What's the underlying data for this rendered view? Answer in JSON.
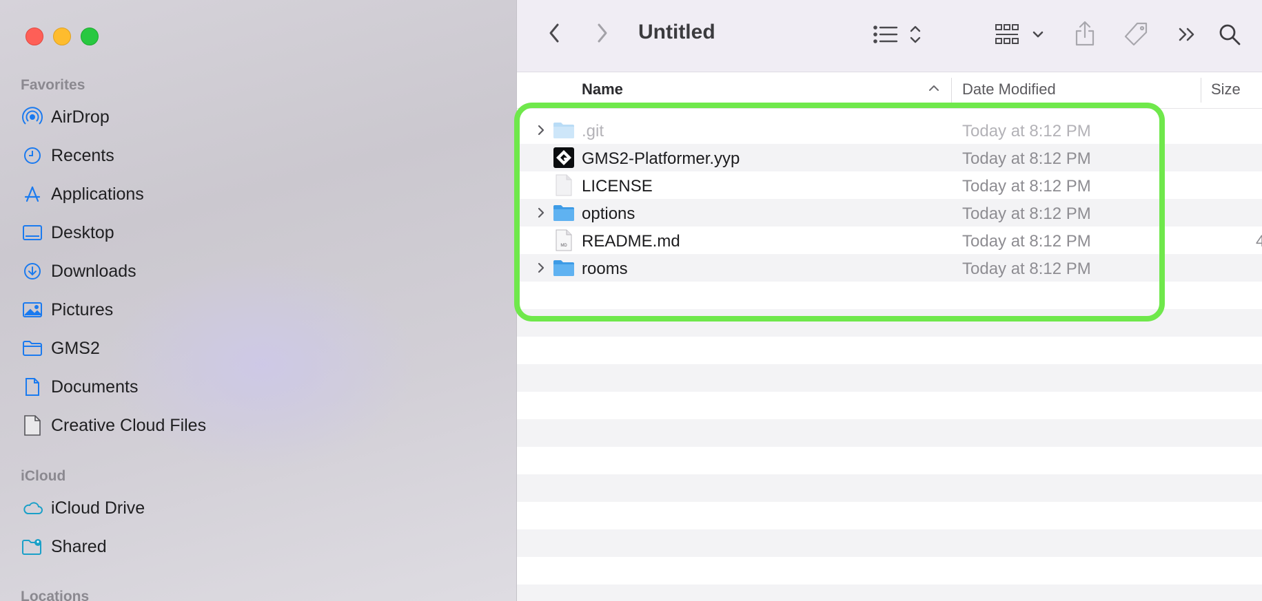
{
  "window": {
    "title": "Untitled"
  },
  "sidebar": {
    "favorites_label": "Favorites",
    "favorites": [
      {
        "label": "AirDrop",
        "icon": "airdrop-icon"
      },
      {
        "label": "Recents",
        "icon": "clock-icon"
      },
      {
        "label": "Applications",
        "icon": "applications-icon"
      },
      {
        "label": "Desktop",
        "icon": "desktop-icon"
      },
      {
        "label": "Downloads",
        "icon": "download-icon"
      },
      {
        "label": "Pictures",
        "icon": "photo-icon"
      },
      {
        "label": "GMS2",
        "icon": "folder-icon"
      },
      {
        "label": "Documents",
        "icon": "document-icon"
      },
      {
        "label": "Creative Cloud Files",
        "icon": "file-icon"
      }
    ],
    "icloud_label": "iCloud",
    "icloud": [
      {
        "label": "iCloud Drive",
        "icon": "cloud-icon"
      },
      {
        "label": "Shared",
        "icon": "shared-folder-icon"
      }
    ],
    "locations_label": "Locations"
  },
  "toolbar": {
    "back": "chevron-left-icon",
    "forward": "chevron-right-icon",
    "view_mode": "list-view-icon",
    "group": "grid-group-icon",
    "share": "share-icon",
    "tags": "tag-icon",
    "more": "double-chevron-icon",
    "search": "search-icon"
  },
  "columns": {
    "name": "Name",
    "date_modified": "Date Modified",
    "size": "Size"
  },
  "files": [
    {
      "name": ".git",
      "date": "Today at 8:12 PM",
      "kind": "folder",
      "expandable": true,
      "hidden": true
    },
    {
      "name": "GMS2-Platformer.yyp",
      "date": "Today at 8:12 PM",
      "kind": "yyp",
      "expandable": false,
      "hidden": false
    },
    {
      "name": "LICENSE",
      "date": "Today at 8:12 PM",
      "kind": "blank",
      "expandable": false,
      "hidden": false
    },
    {
      "name": "options",
      "date": "Today at 8:12 PM",
      "kind": "folder",
      "expandable": true,
      "hidden": false
    },
    {
      "name": "README.md",
      "date": "Today at 8:12 PM",
      "kind": "md",
      "expandable": false,
      "hidden": false
    },
    {
      "name": "rooms",
      "date": "Today at 8:12 PM",
      "kind": "folder",
      "expandable": true,
      "hidden": false
    }
  ],
  "readme_size_partial": "4",
  "colors": {
    "accent": "#1a7aef",
    "highlight_box": "#6fe84b",
    "close": "#fe5f57",
    "minimize": "#febc2e",
    "maximize": "#28c840"
  }
}
